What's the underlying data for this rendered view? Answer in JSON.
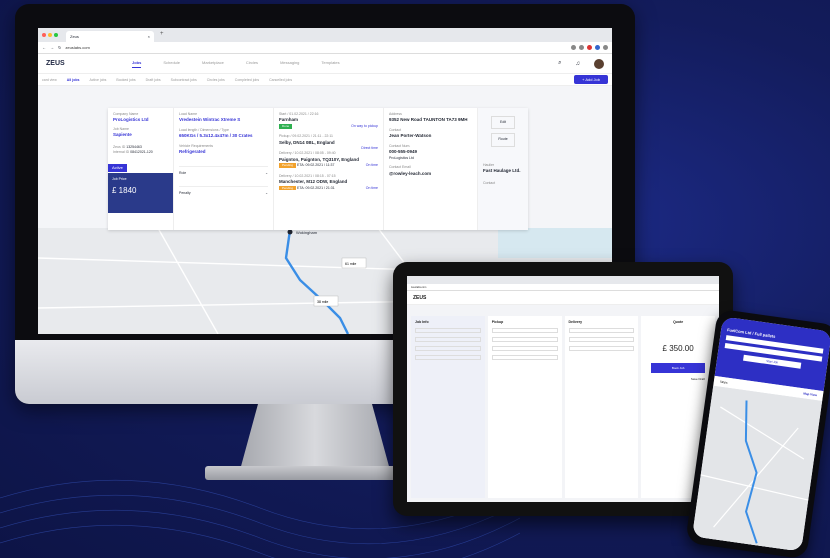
{
  "browser": {
    "tab_title": "Zeus",
    "url": "zeuslabs.com"
  },
  "app": {
    "logo": "ZEUS",
    "nav": [
      "Jobs",
      "Schedule",
      "Marketplace",
      "Circles",
      "Messaging",
      "Templates"
    ],
    "subbar": {
      "left": "card view",
      "tabs": [
        "All jobs",
        "Active jobs",
        "Booked jobs",
        "Draft jobs",
        "Subcontract jobs",
        "Circles jobs",
        "Completed jobs",
        "Cancelled jobs"
      ],
      "add_label": "+ Add Job"
    }
  },
  "job": {
    "company_label": "Company Name",
    "company": "ProLogistics Ltd",
    "job_name_label": "Job Name",
    "job_name": "Sapiente",
    "zeus_id_label": "Zeus ID",
    "zeus_id": "13254463",
    "internal_id_label": "Internal ID",
    "internal_id": "08412021-120",
    "status": "Active",
    "price_label": "Job Price",
    "price": "£ 1840",
    "load_name_label": "Load Name",
    "load_name": "Vredestein Wintrac Xtreme S",
    "dims_label": "Load length / Dimensions / Type",
    "dims": "650KGs / 5.3x12.4x47m / 30 Crates",
    "vehicle_label": "Vehicle Requirements",
    "vehicle": "Refrigerated",
    "role_label": "Role",
    "penalty_label": "Penalty"
  },
  "stops": [
    {
      "meta": "Start / 01.02.2021 / 22:16",
      "addr": "Farnham",
      "badge": "Done",
      "badge_type": "g",
      "link": "On way to pickup"
    },
    {
      "meta": "Pickup / 09.02.2021 / 21:11 - 22:11",
      "addr": "Selby, DN14 0BL, England",
      "badge": "",
      "badge_type": "",
      "link": "Direct time"
    },
    {
      "meta": "Delivery / 10.02.2021 / 08:05 - 09:40",
      "addr": "Paignton, Paignton, TQ310Y, England",
      "badge": "Pending",
      "badge_type": "o",
      "link": "On time",
      "eta": "ETA: 09.02.2021 / 11:37"
    },
    {
      "meta": "Delivery / 10.02.2021 / 08:15 - 07:15",
      "addr": "Manchester, M12 ODW, England",
      "badge": "Pending",
      "badge_type": "o",
      "link": "On time",
      "eta": "ETA: 09.02.2021 / 21:31"
    }
  ],
  "contact": {
    "address_label": "Address",
    "address": "9352 New Road TAUNTON TA73 9MH",
    "contact_label": "Contact",
    "contact": "Jean Porter-Watson",
    "phone_label": "Contact Num.",
    "phone": "000-555-0949",
    "company": "ProLogistics Ltd",
    "email_label": "Contact Email",
    "email": "@rowley-leach.com"
  },
  "haulier": {
    "edit": "Edit",
    "route": "Route",
    "label": "Haulier",
    "name": "Fast Haulage Ltd.",
    "contact_label": "Contact"
  },
  "map": {
    "place": "Wokingham",
    "leg1": "61 mile",
    "leg2": "38 mile"
  },
  "tablet": {
    "url": "zeuslabs.com",
    "logo": "ZEUS",
    "cols": [
      "Job Info",
      "Pickup",
      "Delivery",
      "Quote"
    ],
    "quote": "£ 350.00",
    "book": "Book Job",
    "save": "Save Draft"
  },
  "phone": {
    "title": "FuelCom Ltd / Full pallets",
    "start": "Start Job",
    "tabs": [
      "Stops",
      "Map View"
    ]
  }
}
